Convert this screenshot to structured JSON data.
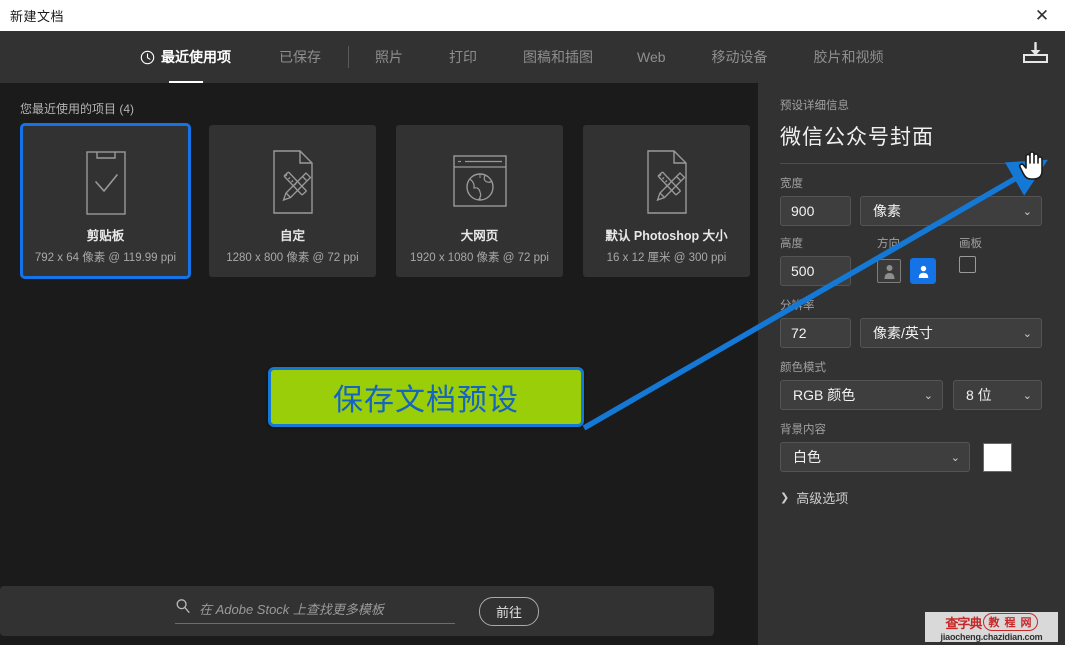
{
  "window": {
    "title": "新建文档",
    "close_icon": "close-icon",
    "close_glyph": "✕"
  },
  "tabs": [
    {
      "label": "最近使用项",
      "icon": "clock-icon",
      "active": true
    },
    {
      "label": "已保存",
      "active": false
    },
    {
      "label": "照片",
      "active": false
    },
    {
      "label": "打印",
      "active": false
    },
    {
      "label": "图稿和插图",
      "active": false
    },
    {
      "label": "Web",
      "active": false
    },
    {
      "label": "移动设备",
      "active": false
    },
    {
      "label": "胶片和视频",
      "active": false
    }
  ],
  "recent": {
    "heading": "您最近使用的项目 (4)",
    "cards": [
      {
        "title": "剪贴板",
        "subtitle": "792 x 64 像素 @ 119.99 ppi",
        "icon": "clipboard-check-icon",
        "selected": true
      },
      {
        "title": "自定",
        "subtitle": "1280 x 800 像素 @ 72 ppi",
        "icon": "document-pencil-ruler-icon",
        "selected": false
      },
      {
        "title": "大网页",
        "subtitle": "1920 x 1080 像素 @ 72 ppi",
        "icon": "browser-globe-icon",
        "selected": false
      },
      {
        "title": "默认 Photoshop 大小",
        "subtitle": "16 x 12 厘米 @ 300 ppi",
        "icon": "document-pencil-ruler-icon",
        "selected": false
      }
    ]
  },
  "annotation": {
    "text": "保存文档预设",
    "fill_color": "#9ace09",
    "border_color": "#1479d6",
    "text_color": "#1565c0",
    "arrow_color": "#1479d6"
  },
  "stock_bar": {
    "search_icon": "search-icon",
    "placeholder": "在 Adobe Stock 上查找更多模板",
    "value": "",
    "go_label": "前往"
  },
  "details": {
    "section_label": "预设详细信息",
    "preset_name": "微信公众号封面",
    "save_preset_icon": "download-save-icon",
    "cursor_icon": "hand-pointer-cursor",
    "width": {
      "label": "宽度",
      "value": "900",
      "unit": "像素"
    },
    "height": {
      "label": "高度",
      "value": "500"
    },
    "orientation": {
      "label": "方向",
      "portrait_icon": "portrait-orientation-icon",
      "landscape_icon": "landscape-orientation-icon",
      "selected": "landscape"
    },
    "artboard": {
      "label": "画板",
      "checked": false
    },
    "resolution": {
      "label": "分辨率",
      "value": "72",
      "unit": "像素/英寸"
    },
    "color_mode": {
      "label": "颜色模式",
      "value": "RGB 颜色",
      "depth": "8 位"
    },
    "background": {
      "label": "背景内容",
      "value": "白色",
      "swatch_color": "#ffffff"
    },
    "advanced": {
      "label": "高级选项",
      "chevron": "❯",
      "expanded": false
    }
  },
  "watermark": {
    "brand": "查字典",
    "pill": "教 程 网",
    "url": "jiaocheng.chazidian.com"
  },
  "colors": {
    "accent_blue": "#1473e6",
    "panel_bg": "#323232",
    "canvas_bg": "#1b1b1b",
    "titlebar_bg": "#ffffff"
  }
}
